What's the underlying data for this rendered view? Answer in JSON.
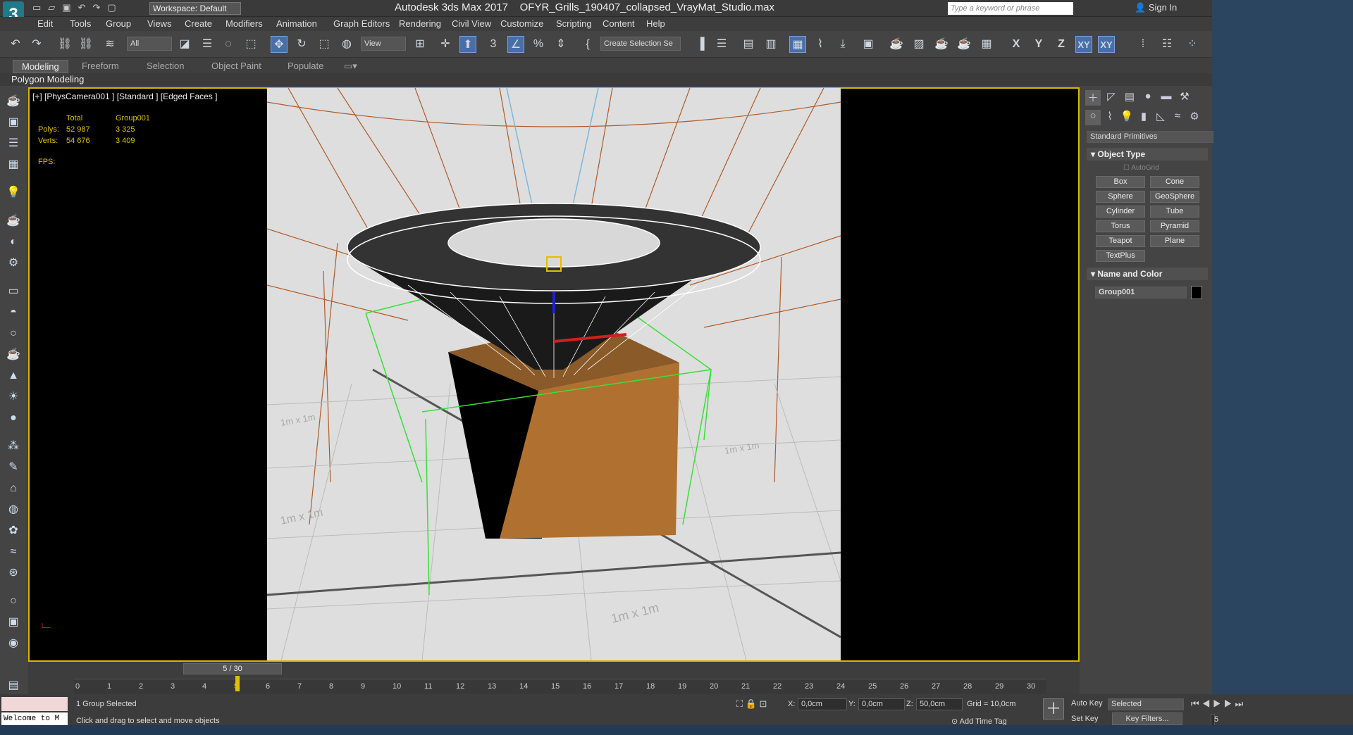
{
  "app": {
    "title": "Autodesk 3ds Max 2017",
    "file": "OFYR_Grills_190407_collapsed_VrayMat_Studio.max",
    "workspace": "Workspace: Default",
    "search_placeholder": "Type a keyword or phrase",
    "sign_in": "Sign In",
    "logo": "3"
  },
  "menu": [
    "Edit",
    "Tools",
    "Group",
    "Views",
    "Create",
    "Modifiers",
    "Animation",
    "Graph Editors",
    "Rendering",
    "Civil View",
    "Customize",
    "Scripting",
    "Content",
    "Help"
  ],
  "toolbar": {
    "selection_filter": "All",
    "ref_coord": "View",
    "named_selection": "Create Selection Se",
    "axis_labels": [
      "X",
      "Y",
      "Z",
      "XY",
      "XY"
    ]
  },
  "ribbon": {
    "tabs": [
      "Modeling",
      "Freeform",
      "Selection",
      "Object Paint",
      "Populate"
    ],
    "active": "Modeling",
    "panel": "Polygon Modeling"
  },
  "viewport": {
    "label": "[+] [PhysCamera001 ] [Standard ] [Edged Faces ]",
    "stats": {
      "col_total": "Total",
      "col_group": "Group001",
      "polys_label": "Polys:",
      "polys_total": "52 987",
      "polys_group": "3 325",
      "verts_label": "Verts:",
      "verts_total": "54 676",
      "verts_group": "3 409",
      "fps_label": "FPS:"
    },
    "grid_labels": [
      "1m x 1m",
      "1m x 1m",
      "1m x 1m",
      "1m x 1m"
    ]
  },
  "command_panel": {
    "category": "Standard Primitives",
    "object_type_title": "Object Type",
    "autogrid": "AutoGrid",
    "buttons": [
      "Box",
      "Cone",
      "Sphere",
      "GeoSphere",
      "Cylinder",
      "Tube",
      "Torus",
      "Pyramid",
      "Teapot",
      "Plane",
      "TextPlus"
    ],
    "name_color_title": "Name and Color",
    "object_name": "Group001",
    "object_color": "#000000"
  },
  "timeline": {
    "frame": "5 / 30",
    "ticks": [
      "0",
      "1",
      "2",
      "3",
      "4",
      "5",
      "6",
      "7",
      "8",
      "9",
      "10",
      "11",
      "12",
      "13",
      "14",
      "15",
      "16",
      "17",
      "18",
      "19",
      "20",
      "21",
      "22",
      "23",
      "24",
      "25",
      "26",
      "27",
      "28",
      "29",
      "30"
    ]
  },
  "status": {
    "selection": "1 Group Selected",
    "prompt": "Click and drag to select and move objects",
    "welcome": "Welcome to M",
    "x_label": "X:",
    "x": "0,0cm",
    "y_label": "Y:",
    "y": "0,0cm",
    "z_label": "Z:",
    "z": "50,0cm",
    "grid": "Grid = 10,0cm",
    "add_time_tag": "Add Time Tag",
    "auto_key": "Auto Key",
    "set_key": "Set Key",
    "key_mode": "Selected",
    "key_filters": "Key Filters...",
    "frame_spinner": "5"
  },
  "colors": {
    "viewport_border": "#d9b400",
    "box_texture": "#b07030",
    "selection_green": "#38e038",
    "accent_blue": "#4a6fa8"
  }
}
